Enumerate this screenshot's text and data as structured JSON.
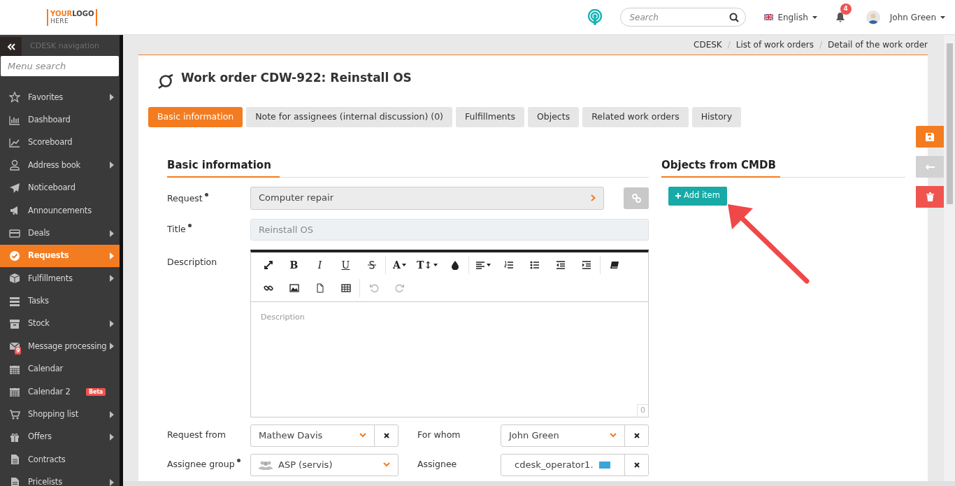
{
  "header": {
    "logo": {
      "line_1a": "YOUR",
      "line_1b": "LOGO",
      "line_2": "HERE"
    },
    "search": {
      "placeholder": "Search"
    },
    "language": "English",
    "notifications": {
      "count": "4"
    },
    "user": "John Green"
  },
  "sidebar": {
    "title": "CDESK navigation",
    "search": {
      "placeholder": "Menu search"
    },
    "items": [
      {
        "label": "Favorites",
        "submenu": true,
        "selected": false
      },
      {
        "label": "Dashboard",
        "submenu": false,
        "selected": false
      },
      {
        "label": "Scoreboard",
        "submenu": false,
        "selected": false
      },
      {
        "label": "Address book",
        "submenu": true,
        "selected": false
      },
      {
        "label": "Noticeboard",
        "submenu": false,
        "selected": false
      },
      {
        "label": "Announcements",
        "submenu": false,
        "selected": false
      },
      {
        "label": "Deals",
        "submenu": true,
        "selected": false
      },
      {
        "label": "Requests",
        "submenu": true,
        "selected": true
      },
      {
        "label": "Fulfillments",
        "submenu": true,
        "selected": false
      },
      {
        "label": "Tasks",
        "submenu": false,
        "selected": false
      },
      {
        "label": "Stock",
        "submenu": true,
        "selected": false
      },
      {
        "label": "Message processing",
        "submenu": true,
        "selected": false,
        "badge": "9"
      },
      {
        "label": "Calendar",
        "submenu": false,
        "selected": false
      },
      {
        "label": "Calendar 2",
        "submenu": false,
        "selected": false,
        "tag": "Beta"
      },
      {
        "label": "Shopping list",
        "submenu": true,
        "selected": false
      },
      {
        "label": "Offers",
        "submenu": true,
        "selected": false
      },
      {
        "label": "Contracts",
        "submenu": false,
        "selected": false
      },
      {
        "label": "Pricelists",
        "submenu": true,
        "selected": false
      }
    ]
  },
  "breadcrumbs": [
    {
      "label": "CDESK"
    },
    {
      "separator": "/",
      "label": "List of work orders"
    },
    {
      "separator": "/",
      "label": "Detail of the work order"
    }
  ],
  "page_title": "Work order CDW-922: Reinstall OS",
  "tabs": [
    {
      "label": "Basic information",
      "selected": true
    },
    {
      "label": "Note for assignees (internal discussion) (0)",
      "selected": false
    },
    {
      "label": "Fulfillments",
      "selected": false
    },
    {
      "label": "Objects",
      "selected": false
    },
    {
      "label": "Related work orders",
      "selected": false
    },
    {
      "label": "History",
      "selected": false
    }
  ],
  "basic_information": {
    "heading": "Basic information",
    "request": {
      "label": "Request",
      "required": true,
      "value": "Computer repair"
    },
    "title": {
      "label": "Title",
      "required": true,
      "value": "Reinstall OS",
      "disabled": true
    },
    "description": {
      "label": "Description",
      "placeholder": "Description",
      "counter": "0",
      "toolbar": [
        [
          {
            "kind": "icon",
            "disabled": false
          },
          {
            "kind": "text",
            "label": "B",
            "disabled": false
          },
          {
            "kind": "text",
            "label": "I",
            "disabled": false
          },
          {
            "kind": "text",
            "label": "U",
            "disabled": false
          },
          {
            "kind": "icon",
            "disabled": false
          },
          {
            "kind": "separator"
          },
          {
            "kind": "dropdown",
            "label": "A",
            "disabled": false
          },
          {
            "kind": "dropdown",
            "label": "T↕",
            "disabled": false
          },
          {
            "kind": "icon",
            "disabled": false
          },
          {
            "kind": "separator"
          },
          {
            "kind": "icon_dropdown",
            "disabled": false
          },
          {
            "kind": "icon",
            "disabled": false
          },
          {
            "kind": "icon",
            "disabled": false
          },
          {
            "kind": "icon",
            "disabled": false
          },
          {
            "kind": "icon",
            "disabled": false
          },
          {
            "kind": "separator"
          },
          {
            "kind": "icon",
            "disabled": false
          }
        ],
        [
          {
            "kind": "icon",
            "disabled": false
          },
          {
            "kind": "icon",
            "disabled": false
          },
          {
            "kind": "icon",
            "disabled": false
          },
          {
            "kind": "icon",
            "disabled": false
          },
          {
            "kind": "separator"
          },
          {
            "kind": "icon",
            "disabled": true
          },
          {
            "kind": "icon",
            "disabled": true
          }
        ]
      ]
    },
    "pairs": [
      [
        {
          "label": "Request from",
          "required": false,
          "value": "Mathew Davis",
          "clearable": true
        },
        {
          "label": "For whom",
          "required": false,
          "value": "John Green",
          "clearable": true
        }
      ],
      [
        {
          "label": "Assignee group",
          "required": true,
          "value": "ASP (servis)",
          "clearable": false
        },
        {
          "label": "Assignee",
          "required": false,
          "value": "cdesk_operator1.",
          "clearable": true
        }
      ]
    ]
  },
  "cmdb": {
    "heading": "Objects from CMDB",
    "add_button": "Add item"
  }
}
